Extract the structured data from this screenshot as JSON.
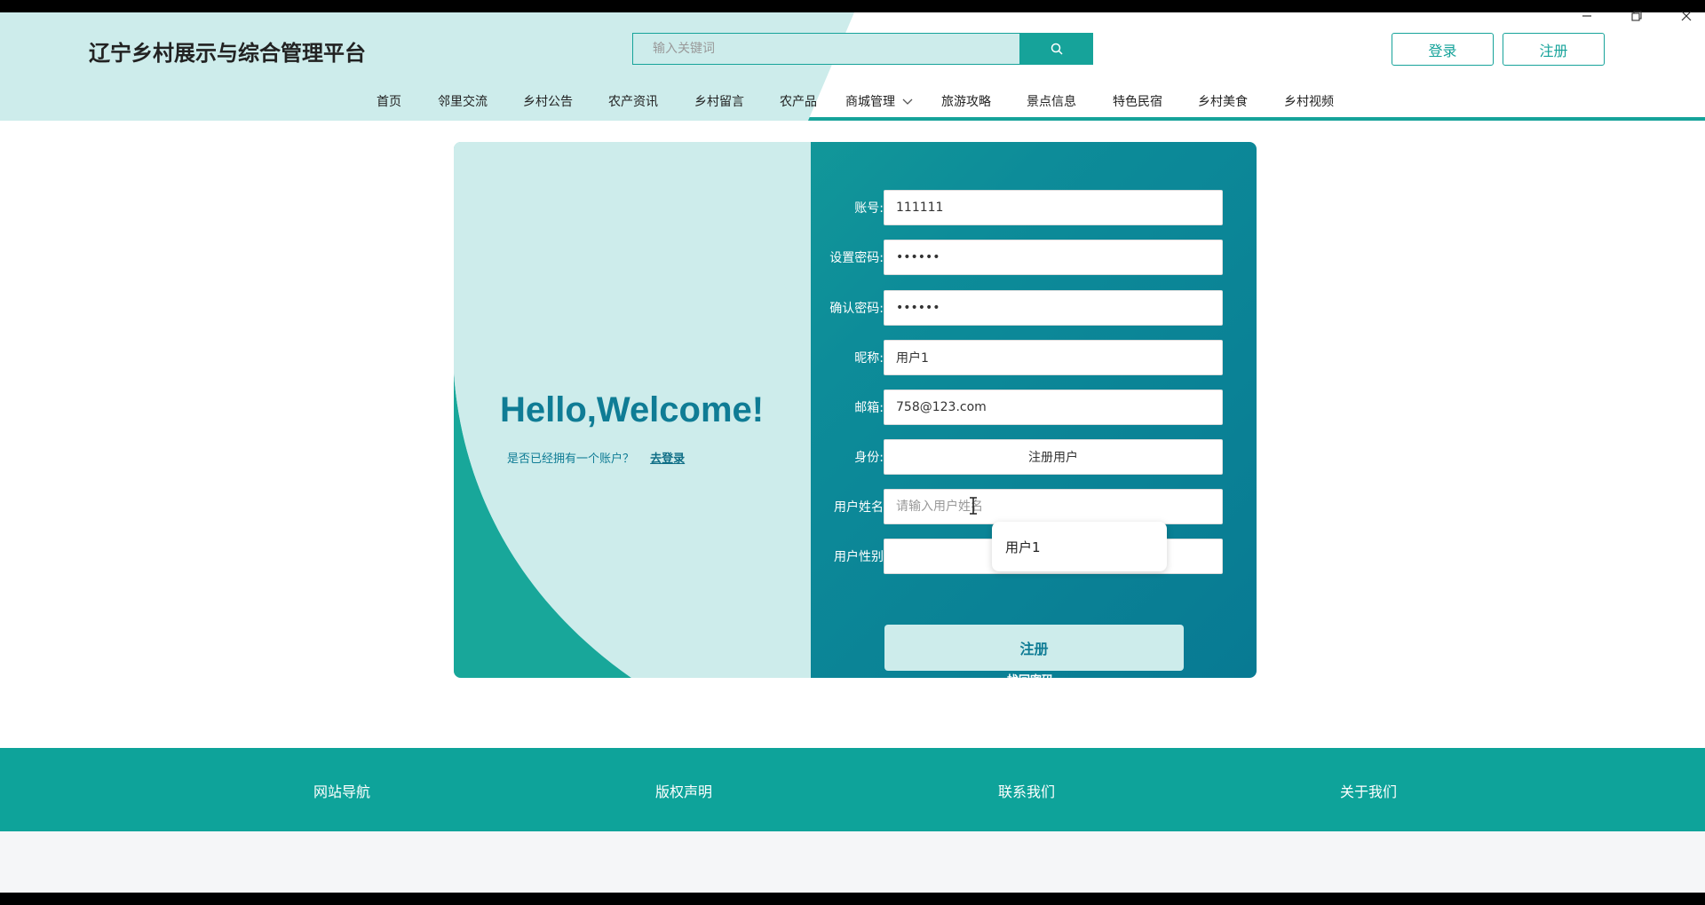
{
  "site": {
    "title": "辽宁乡村展示与综合管理平台"
  },
  "search": {
    "placeholder": "输入关键词",
    "button_icon": "search-icon"
  },
  "auth": {
    "login_label": "登录",
    "register_label": "注册"
  },
  "nav": {
    "items": [
      "首页",
      "邻里交流",
      "乡村公告",
      "农产资讯",
      "乡村留言",
      "农产品",
      "商城管理",
      "旅游攻略",
      "景点信息",
      "特色民宿",
      "乡村美食",
      "乡村视频"
    ],
    "dropdown_icon": "chevron-down-icon"
  },
  "welcome": {
    "title": "Hello,Welcome!",
    "question": "是否已经拥有一个账户？",
    "login_link": "去登录"
  },
  "form": {
    "account": {
      "label": "账号:",
      "value": "111111"
    },
    "password": {
      "label": "设置密码:",
      "value": "111111"
    },
    "confirm_password": {
      "label": "确认密码:",
      "value": "111111"
    },
    "nickname": {
      "label": "昵称:",
      "value": "用户1"
    },
    "email": {
      "label": "邮箱:",
      "value": "758@123.com"
    },
    "role": {
      "label": "身份:",
      "value": "注册用户"
    },
    "username": {
      "label": "用户姓名",
      "value": "",
      "placeholder": "请输入用户姓名"
    },
    "gender": {
      "label": "用户性别",
      "value": ""
    },
    "submit_label": "注册",
    "forgot_label": "找回密码"
  },
  "autocomplete": {
    "option": "用户1"
  },
  "footer": {
    "items": [
      "网站导航",
      "版权声明",
      "联系我们",
      "关于我们"
    ]
  },
  "colors": {
    "primary": "#16a39a",
    "light": "#cdeceb",
    "dark": "#087a93",
    "welcome_text": "#0f7c95"
  }
}
